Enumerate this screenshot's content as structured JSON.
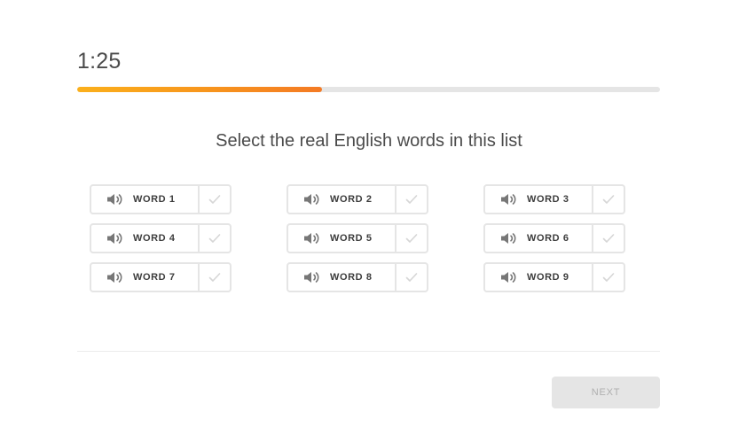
{
  "header": {
    "timer": "1:25",
    "progress": 0.42,
    "progress_color": "#f7941d"
  },
  "prompt": "Select the real English words in this list",
  "words": [
    {
      "label": "WORD 1",
      "icon": "speaker-icon",
      "check_icon": "check-icon"
    },
    {
      "label": "WORD 2",
      "icon": "speaker-icon",
      "check_icon": "check-icon"
    },
    {
      "label": "WORD 3",
      "icon": "speaker-icon",
      "check_icon": "check-icon"
    },
    {
      "label": "WORD 4",
      "icon": "speaker-icon",
      "check_icon": "check-icon"
    },
    {
      "label": "WORD 5",
      "icon": "speaker-icon",
      "check_icon": "check-icon"
    },
    {
      "label": "WORD 6",
      "icon": "speaker-icon",
      "check_icon": "check-icon"
    },
    {
      "label": "WORD 7",
      "icon": "speaker-icon",
      "check_icon": "check-icon"
    },
    {
      "label": "WORD 8",
      "icon": "speaker-icon",
      "check_icon": "check-icon"
    },
    {
      "label": "WORD 9",
      "icon": "speaker-icon",
      "check_icon": "check-icon"
    }
  ],
  "footer": {
    "next_label": "NEXT",
    "next_disabled": true
  },
  "colors": {
    "text": "#4b4b4b",
    "border": "#e5e5e5",
    "button_disabled_bg": "#e5e5e5",
    "button_disabled_text": "#afafaf"
  }
}
